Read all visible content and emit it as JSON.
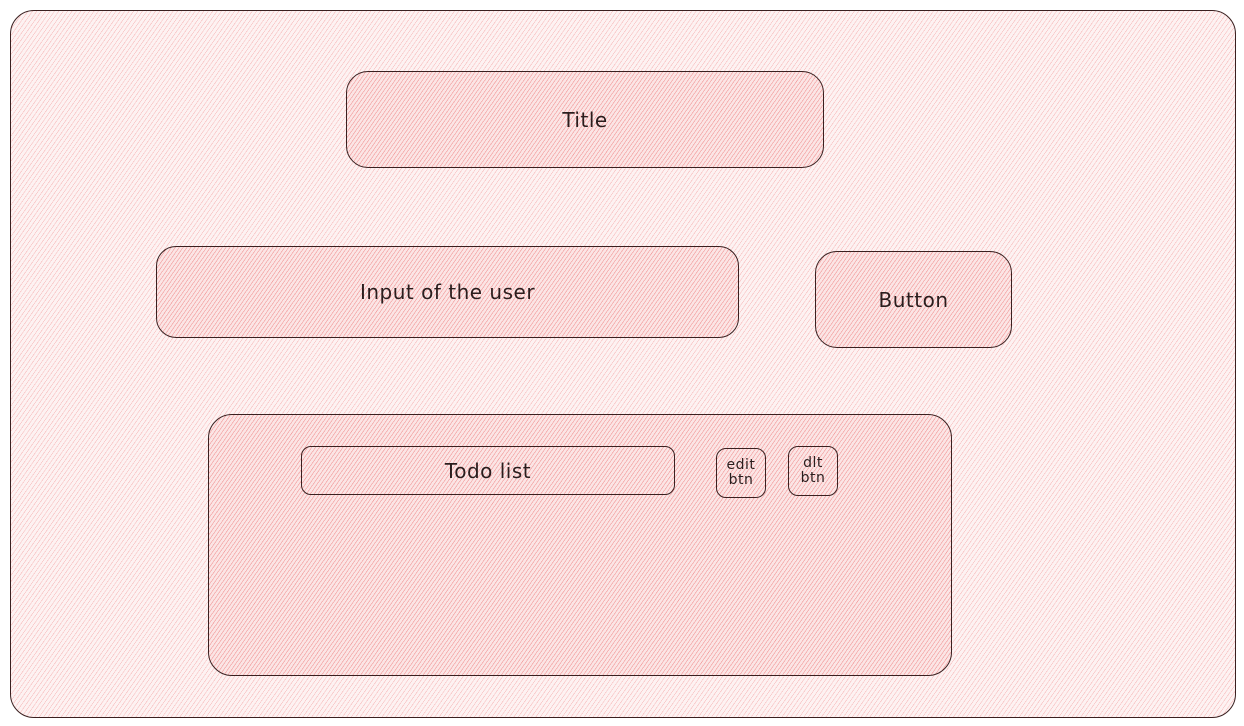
{
  "colors": {
    "fill": "#fbe5e5",
    "hatch": "#ec6e6e",
    "stroke": "#3a2020"
  },
  "wireframe": {
    "title_label": "Title",
    "input_label": "Input of the user",
    "button_label": "Button",
    "todo_list_label": "Todo list",
    "edit_btn_label": "edit\nbtn",
    "dlt_btn_label": "dlt\nbtn"
  }
}
